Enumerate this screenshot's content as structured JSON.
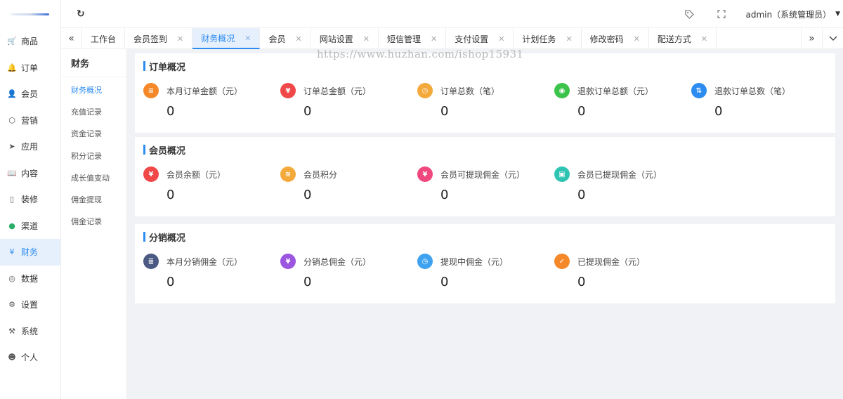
{
  "colors": {
    "accent": "#2d8cf0",
    "nav_active_bg": "#e6f0fc"
  },
  "header": {
    "user": "admin（系统管理员）",
    "refresh_icon": "refresh-icon",
    "tag_icon": "tag-icon",
    "fullscreen_icon": "fullscreen-icon"
  },
  "nav": [
    {
      "label": "商品",
      "icon": "cart-icon"
    },
    {
      "label": "订单",
      "icon": "bell-icon"
    },
    {
      "label": "会员",
      "icon": "user-icon"
    },
    {
      "label": "营销",
      "icon": "box-icon"
    },
    {
      "label": "应用",
      "icon": "send-icon"
    },
    {
      "label": "内容",
      "icon": "book-icon"
    },
    {
      "label": "装修",
      "icon": "phone-icon"
    },
    {
      "label": "渠道",
      "icon": "wechat-icon"
    },
    {
      "label": "财务",
      "icon": "yen-icon"
    },
    {
      "label": "数据",
      "icon": "globe-icon"
    },
    {
      "label": "设置",
      "icon": "gear-icon"
    },
    {
      "label": "系统",
      "icon": "tools-icon"
    },
    {
      "label": "个人",
      "icon": "person-icon"
    }
  ],
  "tabs": [
    {
      "label": "工作台",
      "closable": false
    },
    {
      "label": "会员签到",
      "closable": true
    },
    {
      "label": "财务概况",
      "closable": true,
      "active": true
    },
    {
      "label": "会员",
      "closable": true
    },
    {
      "label": "网站设置",
      "closable": true
    },
    {
      "label": "短信管理",
      "closable": true
    },
    {
      "label": "支付设置",
      "closable": true
    },
    {
      "label": "计划任务",
      "closable": true
    },
    {
      "label": "修改密码",
      "closable": true
    },
    {
      "label": "配送方式",
      "closable": true
    }
  ],
  "submenu": {
    "title": "财务",
    "items": [
      "财务概况",
      "充值记录",
      "资金记录",
      "积分记录",
      "成长值变动",
      "佣金提现",
      "佣金记录"
    ]
  },
  "watermark": "https://www.huzhan.com/ishop15931",
  "panels": [
    {
      "title": "订单概况",
      "stats": [
        {
          "label": "本月订单金额（元）",
          "value": "0",
          "color": "#f5892a",
          "icon": "doc-icon",
          "glyph": "≡"
        },
        {
          "label": "订单总金额（元）",
          "value": "0",
          "color": "#f04848",
          "icon": "yen-icon",
          "glyph": "¥"
        },
        {
          "label": "订单总数（笔）",
          "value": "0",
          "color": "#f4a93b",
          "icon": "clock-icon",
          "glyph": "◷"
        },
        {
          "label": "退款订单总额（元）",
          "value": "0",
          "color": "#3cc34a",
          "icon": "refund-icon",
          "glyph": "◉"
        },
        {
          "label": "退款订单总数（笔）",
          "value": "0",
          "color": "#2d8cf0",
          "icon": "exchange-icon",
          "glyph": "⇅"
        }
      ]
    },
    {
      "title": "会员概况",
      "stats": [
        {
          "label": "会员余额（元）",
          "value": "0",
          "color": "#f04848",
          "icon": "yen-icon",
          "glyph": "¥"
        },
        {
          "label": "会员积分",
          "value": "0",
          "color": "#f4a93b",
          "icon": "coins-icon",
          "glyph": "≋"
        },
        {
          "label": "会员可提现佣金（元）",
          "value": "0",
          "color": "#f0477f",
          "icon": "ticket-icon",
          "glyph": "¥"
        },
        {
          "label": "会员已提现佣金（元）",
          "value": "0",
          "color": "#2fc4b2",
          "icon": "wallet-icon",
          "glyph": "▣"
        }
      ]
    },
    {
      "title": "分销概况",
      "stats": [
        {
          "label": "本月分销佣金（元）",
          "value": "0",
          "color": "#4a5a82",
          "icon": "list-icon",
          "glyph": "≣"
        },
        {
          "label": "分销总佣金（元）",
          "value": "0",
          "color": "#9b55e0",
          "icon": "yen-icon",
          "glyph": "¥"
        },
        {
          "label": "提现中佣金（元）",
          "value": "0",
          "color": "#3fa2f0",
          "icon": "clock-icon",
          "glyph": "◷"
        },
        {
          "label": "已提现佣金（元）",
          "value": "0",
          "color": "#f5892a",
          "icon": "check-icon",
          "glyph": "✓"
        }
      ]
    }
  ]
}
